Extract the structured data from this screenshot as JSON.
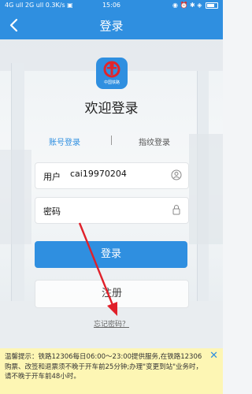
{
  "status_bar": {
    "left": "4G ull 2G ull 0.3K/s ▣",
    "time": "15:06",
    "right": "◉ ⏰ ✱ ◈"
  },
  "header": {
    "title": "登录"
  },
  "logo": {
    "text": "中国铁路"
  },
  "welcome": "欢迎登录",
  "tabs": {
    "account": "账号登录",
    "fingerprint": "指纹登录"
  },
  "form": {
    "user_label": "用户",
    "user_value": "cai19970204",
    "password_label": "密码",
    "password_value": ""
  },
  "buttons": {
    "login": "登录",
    "register": "注册",
    "forgot": "忘记密码？"
  },
  "notice": {
    "text": "温馨提示：铁路12306每日06:00～23:00提供服务,在铁路12306购票、改签和退票须不晚于开车前25分钟;办理\"变更到站\"业务时，请不晚于开车前48小时。",
    "close": "✕"
  },
  "colors": {
    "brand": "#2f8fe0",
    "notice_bg": "#fdf6b4",
    "annotation": "#e0202a"
  }
}
